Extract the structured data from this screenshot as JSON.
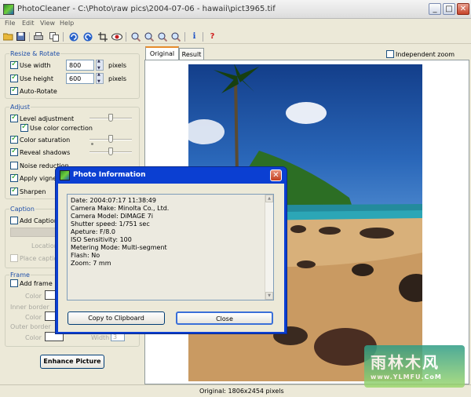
{
  "window": {
    "title": "PhotoCleaner - C:\\Photo\\raw pics\\2004-07-06 - hawaii\\pict3965.tif",
    "minimize": "_",
    "maximize": "□",
    "close": "✕"
  },
  "menu": [
    "File",
    "Edit",
    "View",
    "Help"
  ],
  "toolbar": {
    "icons": [
      "open-folder-icon",
      "save-icon",
      "print-icon",
      "copy-icon",
      "rotate-left-icon",
      "rotate-right-icon",
      "crop-icon",
      "red-eye-icon",
      "zoom-in-icon",
      "zoom-out-icon",
      "zoom-fit-icon",
      "zoom-actual-icon",
      "info-icon",
      "help-icon"
    ],
    "info_glyph": "i",
    "help_glyph": "?"
  },
  "resize": {
    "title": "Resize & Rotate",
    "use_width_label": "Use width",
    "use_width_checked": true,
    "width_value": "800",
    "width_unit": "pixels",
    "use_height_label": "Use height",
    "use_height_checked": true,
    "height_value": "600",
    "height_unit": "pixels",
    "auto_rotate_label": "Auto-Rotate",
    "auto_rotate_checked": true
  },
  "adjust": {
    "title": "Adjust",
    "level_label": "Level adjustment",
    "use_color_label": "Use color correction",
    "saturation_label": "Color saturation",
    "shadows_label": "Reveal shadows",
    "noise_label": "Noise reduction",
    "vignetting_label": "Apply vignet",
    "sharpen_label": "Sharpen"
  },
  "caption": {
    "title": "Caption",
    "add_label": "Add Caption",
    "location_label": "Location",
    "place_label": "Place caption"
  },
  "frame": {
    "title": "Frame",
    "add_label": "Add frame",
    "color_label": "Color",
    "inner_label": "Inner border",
    "outer_label": "Outer border",
    "width_label": "Width",
    "width_value": "3"
  },
  "enhance_button": "Enhance Picture",
  "tabs": {
    "original": "Original",
    "result": "Result"
  },
  "independent_zoom": "Independent zoom",
  "status": "Original: 1806x2454 pixels",
  "dialog": {
    "title": "Photo Information",
    "close_glyph": "✕",
    "lines": [
      "Date: 2004:07:17 11:38:49",
      "Camera Make: Minolta Co., Ltd.",
      "Camera Model: DiMAGE 7i",
      "Shutter speed: 1/751 sec",
      "Apeture: F/8.0",
      "ISO Sensitivity: 100",
      "Metering Mode: Multi-segment",
      "Flash: No",
      "Zoom: 7 mm"
    ],
    "copy_button": "Copy to Clipboard",
    "close_button": "Close"
  },
  "watermark": {
    "text": "雨林木风",
    "url": "www.YLMFU.CoM"
  }
}
